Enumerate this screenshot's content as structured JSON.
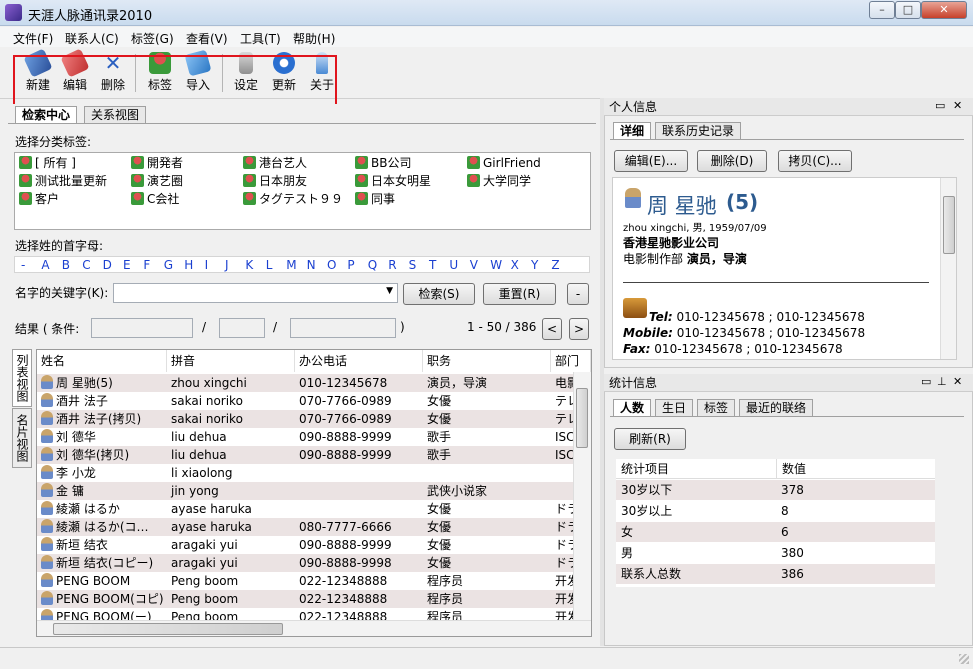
{
  "window": {
    "title": "天涯人脉通讯录2010"
  },
  "menu": [
    "文件(F)",
    "联系人(C)",
    "标签(G)",
    "查看(V)",
    "工具(T)",
    "帮助(H)"
  ],
  "toolbar": [
    "新建",
    "编辑",
    "删除",
    "标签",
    "导入",
    "设定",
    "更新",
    "关于"
  ],
  "left_tabs": [
    "检索中心",
    "关系视图"
  ],
  "tag_section": {
    "label": "选择分类标签:",
    "tags": [
      "[ 所有 ]",
      "開発者",
      "港台艺人",
      "BB公司",
      "GirlFriend",
      "测试批量更新",
      "演艺圈",
      "日本朋友",
      "日本女明星",
      "大学同学",
      "客户",
      "C会社",
      "タグテスト９９",
      "同事"
    ]
  },
  "initials": {
    "label": "选择姓的首字母:",
    "letters": [
      "-",
      "A",
      "B",
      "C",
      "D",
      "E",
      "F",
      "G",
      "H",
      "I",
      "J",
      "K",
      "L",
      "M",
      "N",
      "O",
      "P",
      "Q",
      "R",
      "S",
      "T",
      "U",
      "V",
      "W",
      "X",
      "Y",
      "Z"
    ]
  },
  "search": {
    "label": "名字的关键字(K):",
    "value": "",
    "search_button": "检索(S)",
    "reset_button": "重置(R)",
    "extra_button": "-"
  },
  "results": {
    "label": "结果 ( 条件:",
    "sep1": "/",
    "sep2": "/",
    "close": ")",
    "range": "1 - 50 / 386",
    "prev": "<",
    "next": ">"
  },
  "vertical_tabs": [
    "列表视图",
    "名片视图"
  ],
  "grid": {
    "columns": [
      "姓名",
      "拼音",
      "办公电话",
      "职务",
      "部门"
    ],
    "rows": [
      {
        "name": "周 星驰(5)",
        "pinyin": "zhou xingchi",
        "phone": "010-12345678",
        "title": "演员，导演",
        "dept": "电影"
      },
      {
        "name": "酒井 法子",
        "pinyin": "sakai noriko",
        "phone": "070-7766-0989",
        "title": "女優",
        "dept": "テレ"
      },
      {
        "name": "酒井 法子(拷贝)",
        "pinyin": "sakai noriko",
        "phone": "070-7766-0989",
        "title": "女優",
        "dept": "テレ"
      },
      {
        "name": "刘 德华",
        "pinyin": "liu dehua",
        "phone": "090-8888-9999",
        "title": "歌手",
        "dept": "ISC"
      },
      {
        "name": "刘 德华(拷贝)",
        "pinyin": "liu dehua",
        "phone": "090-8888-9999",
        "title": "歌手",
        "dept": "ISC"
      },
      {
        "name": "李 小龙",
        "pinyin": "li xiaolong",
        "phone": "",
        "title": "",
        "dept": ""
      },
      {
        "name": "金 镛",
        "pinyin": "jin yong",
        "phone": "",
        "title": "武侠小说家",
        "dept": ""
      },
      {
        "name": "綾瀬 はるか",
        "pinyin": "ayase haruka",
        "phone": "",
        "title": "女優",
        "dept": "ドラ"
      },
      {
        "name": "綾瀬 はるか(コ…",
        "pinyin": "ayase haruka",
        "phone": "080-7777-6666",
        "title": "女優",
        "dept": "ドラ"
      },
      {
        "name": "新垣 结衣",
        "pinyin": "aragaki yui",
        "phone": "090-8888-9999",
        "title": "女優",
        "dept": "ドラ"
      },
      {
        "name": "新垣 结衣(コピー)",
        "pinyin": "aragaki yui",
        "phone": "090-8888-9998",
        "title": "女優",
        "dept": "ドラ"
      },
      {
        "name": "PENG BOOM",
        "pinyin": "Peng boom",
        "phone": "022-12348888",
        "title": "程序员",
        "dept": "开发"
      },
      {
        "name": "PENG BOOM(コピ)",
        "pinyin": "Peng boom",
        "phone": "022-12348888",
        "title": "程序员",
        "dept": "开发"
      },
      {
        "name": "PENG BOOM(ー)",
        "pinyin": "Peng boom",
        "phone": "022-12348888",
        "title": "程序员",
        "dept": "开发"
      }
    ]
  },
  "personal": {
    "pane_title": "个人信息",
    "tabs": [
      "详细",
      "联系历史记录"
    ],
    "buttons": [
      "编辑(E)...",
      "删除(D)",
      "拷贝(C)..."
    ],
    "card": {
      "name": "周 星驰",
      "count": "(5)",
      "sub": "zhou xingchi, 男, 1959/07/09",
      "company": "香港星驰影业公司",
      "dept": "电影制作部",
      "role": "演员，导演",
      "tel_label": "Tel:",
      "tel": "010-12345678 ; 010-12345678",
      "mobile_label": "Mobile:",
      "mobile": "010-12345678 ; 010-12345678",
      "fax_label": "Fax:",
      "fax": "010-12345678 ; 010-12345678"
    }
  },
  "stats": {
    "pane_title": "统计信息",
    "tabs": [
      "人数",
      "生日",
      "标签",
      "最近的联络"
    ],
    "refresh": "刷新(R)",
    "columns": [
      "统计项目",
      "数值"
    ],
    "rows": [
      {
        "item": "30岁以下",
        "value": "378"
      },
      {
        "item": "30岁以上",
        "value": "8"
      },
      {
        "item": "女",
        "value": "6"
      },
      {
        "item": "男",
        "value": "380"
      },
      {
        "item": "联系人总数",
        "value": "386"
      }
    ]
  },
  "colors": {
    "highlight": "#e0151d",
    "letter": "#1a3fd0",
    "name_title": "#2d5b8f",
    "alt_row": "#ebe3e3"
  },
  "icons": [
    "app-icon",
    "new-contact-icon",
    "edit-icon",
    "delete-icon",
    "tag-icon",
    "import-icon",
    "settings-icon",
    "update-icon",
    "about-icon",
    "person-icon",
    "briefcase-icon",
    "tag-group-icon"
  ]
}
